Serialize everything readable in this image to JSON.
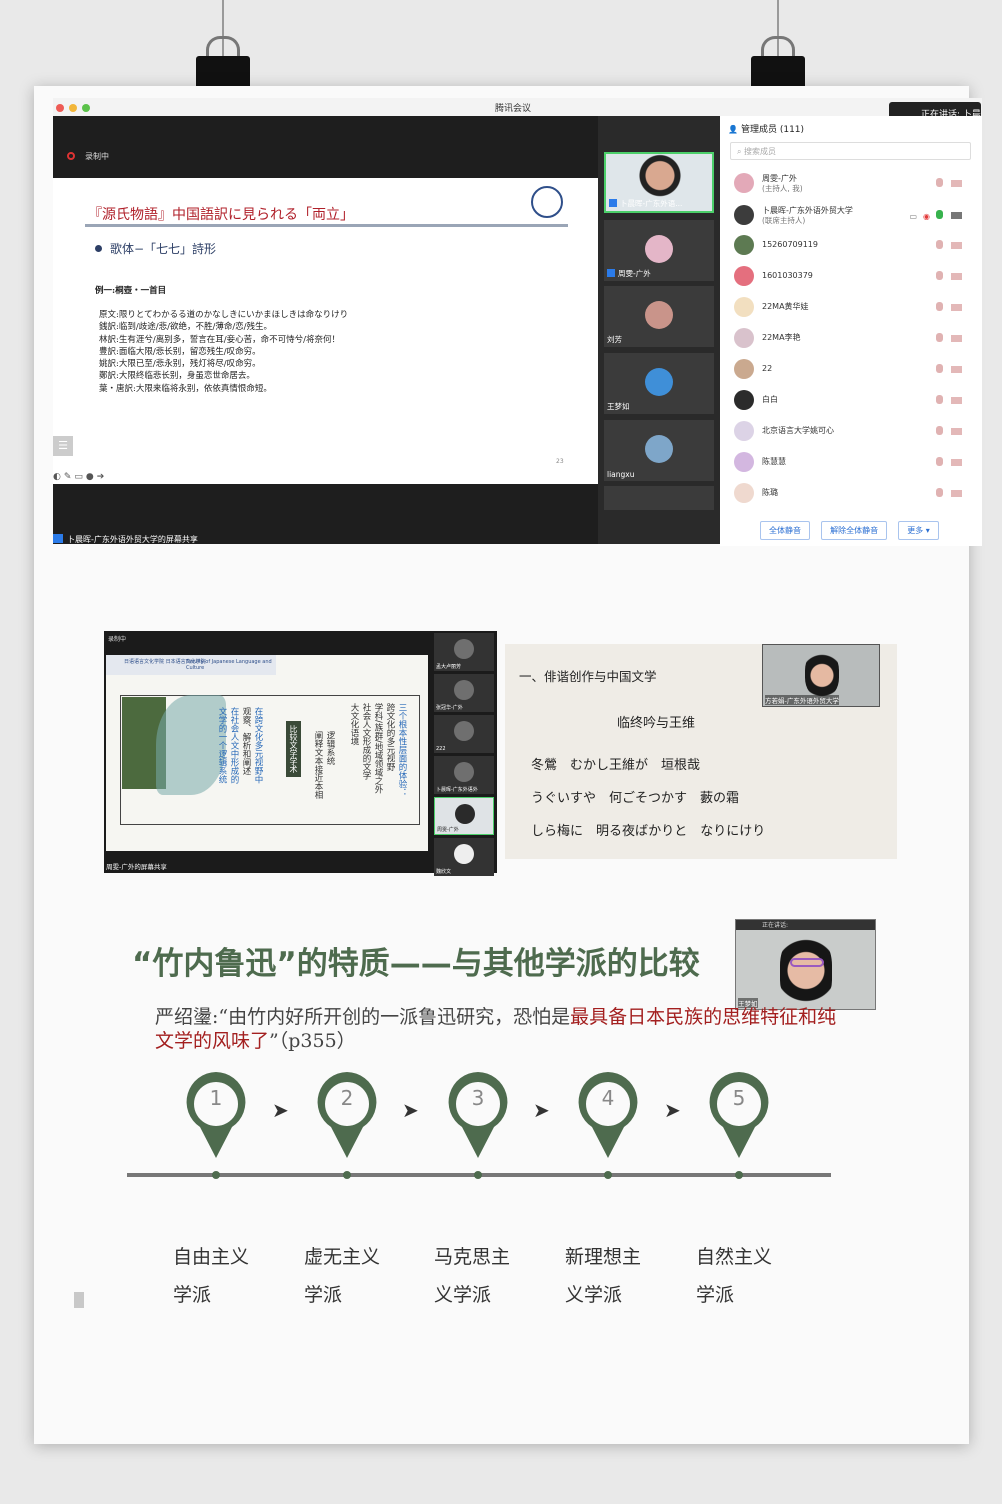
{
  "meeting": {
    "app_title": "腾讯会议",
    "speaking_badge": "正在讲话: 卜晨",
    "recording_label": "录制中",
    "share_bar_label": "卜晨晖-广东外语外贸大学的屏幕共享",
    "slide": {
      "title": "『源氏物語』中国語訳に見られる「両立」",
      "bullet": "歌体−「七七」詩形",
      "example_label": "例一:桐壺・一首目",
      "lines": [
        "原文:限りとてわかるる道のかなしきにいかまほしきは命なりけり",
        "銭訳:临到/歧途/悲/欲绝，不胜/薄命/恋/残生。",
        "林訳:生有涯兮/离别多，誓言在耳/妾心苦，命不可恃兮/将奈何！",
        "豊訳:面临大限/悲长别，留恋残生/叹命穷。",
        "姚訳:大限已至/悲永别，残灯将尽/叹命穷。",
        "鄭訳:大限终临悲长别，身虽恋世命居去。",
        "葉・唐訳:大限来临将永别，依依真情恨命短。"
      ],
      "page_number": "23",
      "menu_icon": "menu-icon"
    },
    "videos": [
      {
        "name": "卜晨晖-广东外语..."
      },
      {
        "name": "周雯-广外"
      },
      {
        "name": "刘芳"
      },
      {
        "name": "王梦如"
      },
      {
        "name": "liangxu"
      }
    ],
    "members": {
      "header": "管理成员 (111)",
      "search_placeholder": "搜索成员",
      "rows": [
        {
          "name": "周雯-广外",
          "sub": "(主持人, 我)"
        },
        {
          "name": "卜晨晖-广东外语外贸大学",
          "sub": "(联席主持人)"
        },
        {
          "name": "15260709119",
          "sub": ""
        },
        {
          "name": "1601030379",
          "sub": ""
        },
        {
          "name": "22MA黄华娃",
          "sub": ""
        },
        {
          "name": "22MA李艳",
          "sub": ""
        },
        {
          "name": "22",
          "sub": ""
        },
        {
          "name": "白白",
          "sub": ""
        },
        {
          "name": "北京语言大学姚可心",
          "sub": ""
        },
        {
          "name": "陈慧慧",
          "sub": ""
        },
        {
          "name": "陈璐",
          "sub": ""
        }
      ],
      "buttons": [
        "全体静音",
        "解除全体静音",
        "更多 ▾"
      ]
    }
  },
  "shot2": {
    "recording_label": "录制中",
    "header_left": "日语语言文化学院 日本语言文化学院",
    "header_right": "Faculty of Japanese Language and Culture",
    "badge": "比较文学学术",
    "columns": [
      {
        "text": "三个根本性层面的体验：",
        "style": "blue"
      },
      {
        "text": "跨文化的多元视野",
        "style": "normal"
      },
      {
        "text": "学科/族群/地域领域之外",
        "style": "normal"
      },
      {
        "text": "社会人文形成的文学",
        "style": "normal"
      },
      {
        "text": "大文化语境",
        "style": "normal"
      },
      {
        "text": "逻辑系统",
        "style": "normal"
      },
      {
        "text": "阐释文本接近本相",
        "style": "normal"
      },
      {
        "text": "在跨文化多元视野中",
        "style": "blue"
      },
      {
        "text": "观察、解析和阐述",
        "style": "normal"
      },
      {
        "text": "在社会人文中形成的",
        "style": "blue"
      },
      {
        "text": "文学的一个逻辑系统",
        "style": "blue"
      }
    ],
    "side_tiles": [
      "孟大卢丽芳",
      "张冠华-广外",
      "222",
      "卜晨晖-广东外语外",
      "周雯-广外",
      "魏欣文"
    ],
    "share_bar_label": "周雯-广外的屏幕共享"
  },
  "shot3": {
    "title": "一、俳谐创作与中国文学",
    "subtitle": "临终吟与王维",
    "lines": [
      "冬鶯　むかし王維が　垣根哉",
      "うぐいすや　何ごそつかす　藪の霜",
      "しら梅に　明る夜ばかりと　なりにけり"
    ],
    "video_label": "方若娟-广东外语外贸大学"
  },
  "bottom": {
    "title": "“竹内鲁迅”的特质——与其他学派的比较",
    "video_top_label": "正在讲话:",
    "video_label": "王梦如",
    "quote_prefix": "严绍璗:“由竹内好所开创的一派鲁迅研究，恐怕是",
    "quote_highlight": "最具备日本民族的思维特征和纯文学的风味了",
    "quote_suffix": "”（p355）",
    "steps": [
      {
        "number": "1",
        "line1": "自由主义",
        "line2": "学派"
      },
      {
        "number": "2",
        "line1": "虚无主义",
        "line2": "学派"
      },
      {
        "number": "3",
        "line1": "马克思主",
        "line2": "义学派"
      },
      {
        "number": "4",
        "line1": "新理想主",
        "line2": "义学派"
      },
      {
        "number": "5",
        "line1": "自然主义",
        "line2": "学派"
      }
    ],
    "accent_color": "#4e6b4e"
  }
}
